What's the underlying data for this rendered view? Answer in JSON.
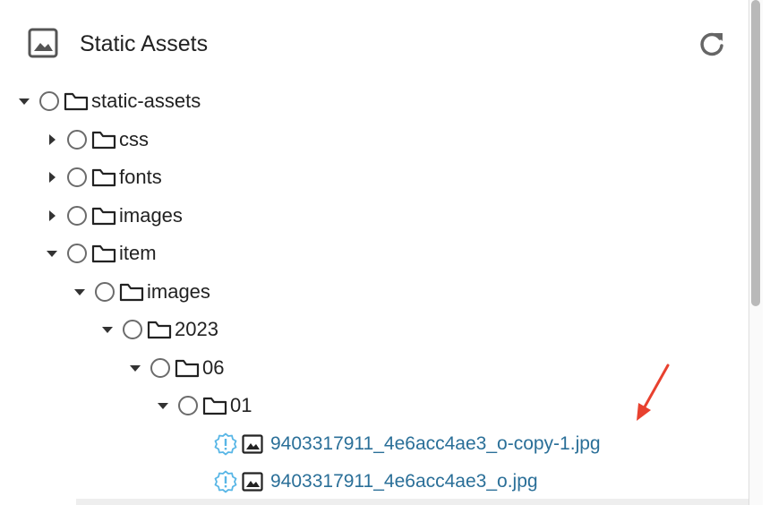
{
  "panel": {
    "title": "Static Assets",
    "header_icon": "image-icon",
    "refresh_icon": "refresh-icon"
  },
  "tree": [
    {
      "label": "static-assets",
      "depth": 0,
      "expanded": true,
      "type": "folder"
    },
    {
      "label": "css",
      "depth": 1,
      "expanded": false,
      "type": "folder"
    },
    {
      "label": "fonts",
      "depth": 1,
      "expanded": false,
      "type": "folder"
    },
    {
      "label": "images",
      "depth": 1,
      "expanded": false,
      "type": "folder"
    },
    {
      "label": "item",
      "depth": 1,
      "expanded": true,
      "type": "folder"
    },
    {
      "label": "images",
      "depth": 2,
      "expanded": true,
      "type": "folder"
    },
    {
      "label": "2023",
      "depth": 3,
      "expanded": true,
      "type": "folder"
    },
    {
      "label": "06",
      "depth": 4,
      "expanded": true,
      "type": "folder"
    },
    {
      "label": "01",
      "depth": 5,
      "expanded": true,
      "type": "folder"
    },
    {
      "label": "9403317911_4e6acc4ae3_o-copy-1.jpg",
      "depth": 6,
      "type": "file",
      "status_icon": "warning-badge-icon"
    },
    {
      "label": "9403317911_4e6acc4ae3_o.jpg",
      "depth": 6,
      "type": "file",
      "status_icon": "warning-badge-icon"
    }
  ],
  "colors": {
    "link": "#2a6f98",
    "warning_badge": "#58b6e6",
    "annotation_arrow": "#e8412f",
    "icon": "#555555"
  }
}
